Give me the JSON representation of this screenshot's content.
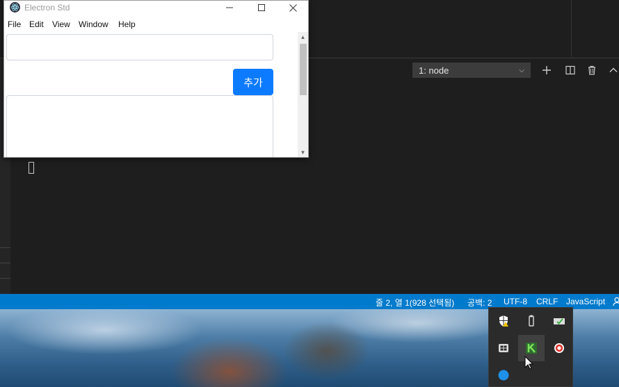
{
  "electron": {
    "title": "Electron Std",
    "menu": [
      "File",
      "Edit",
      "View",
      "Window",
      "Help"
    ],
    "input_value": "",
    "add_button": "추가",
    "textarea_value": ""
  },
  "vscode": {
    "terminal_select": "1: node",
    "status": {
      "position": "줄 2, 열 1(928 선택됨)",
      "spaces": "공백: 2",
      "encoding": "UTF-8",
      "eol": "CRLF",
      "language": "JavaScript"
    }
  },
  "tray": {
    "icons": [
      "windows-security-warning-icon",
      "usb-drive-icon",
      "onedrive-sync-icon",
      "app-grid-icon",
      "keepass-icon",
      "record-icon",
      "blue-dot-icon"
    ]
  },
  "colors": {
    "status_bar": "#007acc",
    "add_button": "#0d7bff",
    "editor_bg": "#1e1e1e"
  }
}
